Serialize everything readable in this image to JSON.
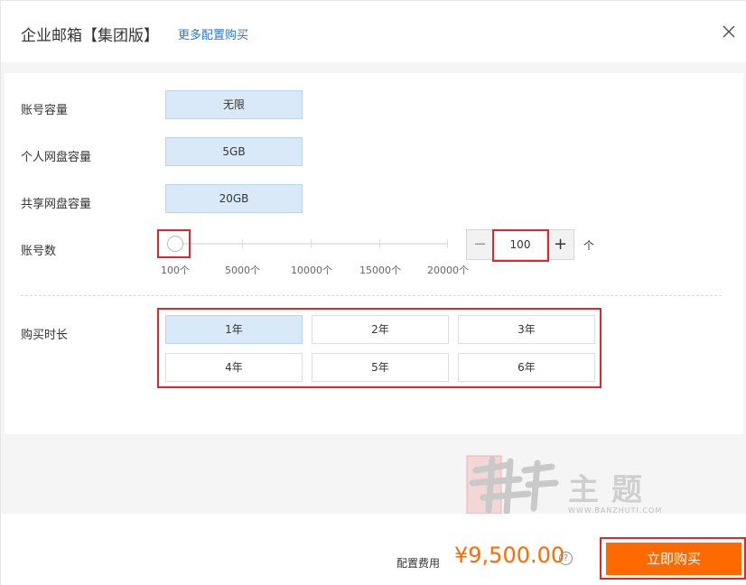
{
  "header": {
    "title": "企业邮箱【集团版】",
    "more_link": "更多配置购买"
  },
  "specs": {
    "account_capacity": {
      "label": "账号容量",
      "value": "无限"
    },
    "personal_disk": {
      "label": "个人网盘容量",
      "value": "5GB"
    },
    "shared_disk": {
      "label": "共享网盘容量",
      "value": "20GB"
    }
  },
  "accounts": {
    "label": "账号数",
    "ticks": [
      "100个",
      "5000个",
      "10000个",
      "15000个",
      "20000个"
    ],
    "value": "100",
    "unit": "个",
    "minus": "−",
    "plus": "+",
    "slider_level": 0
  },
  "duration": {
    "label": "购买时长",
    "options": [
      "1年",
      "2年",
      "3年",
      "4年",
      "5年",
      "6年"
    ],
    "selected": "1年"
  },
  "watermark": {
    "text": "主题",
    "url": "WWW.BANZHUTI.COM"
  },
  "footer": {
    "fee_label": "配置费用",
    "fee_value": "¥9,500.00",
    "help": "?",
    "buy_label": "立即购买"
  },
  "colors": {
    "accent": "#ff6a00",
    "link": "#2a77c9",
    "selected_bg": "#d9e9f8",
    "highlight_box": "#e0262d"
  }
}
